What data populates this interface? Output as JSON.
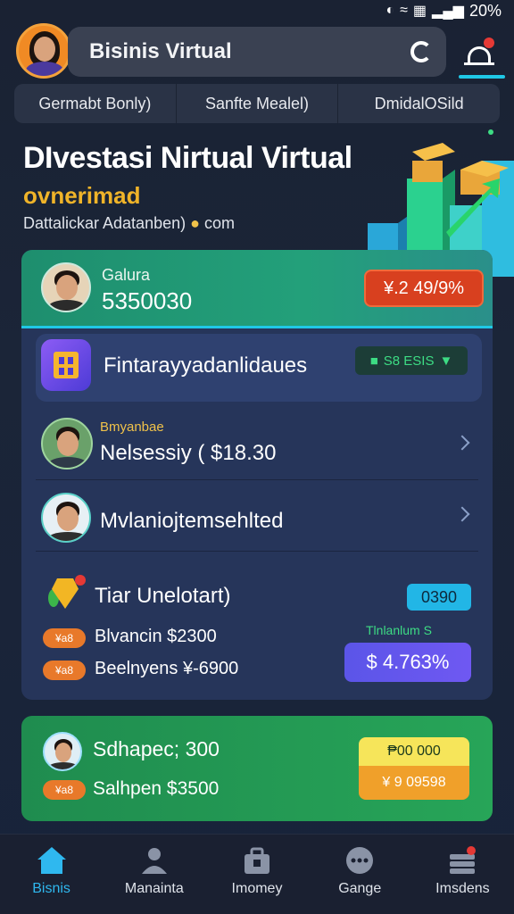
{
  "status_bar": {
    "icons": [
      "nfc-icon",
      "wifi-icon",
      "vibrate-icon",
      "signal-icon"
    ],
    "battery": "20%"
  },
  "header": {
    "title": "Bisinis Virtual"
  },
  "tabs": [
    {
      "label": "Germabt Bonly)"
    },
    {
      "label": "Sanfte Mealel)"
    },
    {
      "label": "DmidalOSild"
    }
  ],
  "hero": {
    "title": "DIvestasi Nirtual Virtual",
    "subtitle": "ovnerimad",
    "caption": "Dattalickar Adatanben)",
    "caption_suffix": "com"
  },
  "card_top": {
    "name": "Galura",
    "amount": "5350030",
    "badge": "¥.2 49/9%"
  },
  "feature": {
    "label": "Fintarayyadanlidaues",
    "pill": "S8 ESIS"
  },
  "list": [
    {
      "tag": "Bmyanbae",
      "label": "Nelsessiy ( $18.30"
    },
    {
      "tag": "",
      "label": "Mvlaniojtemsehlted"
    }
  ],
  "tier": {
    "title": "Tiar Unelotart)",
    "badge": "0390",
    "lines": [
      {
        "chip": "¥a8",
        "text": "Blvancin $2300"
      },
      {
        "chip": "¥a8",
        "text": "Beelnyens ¥-6900"
      }
    ],
    "note": "Tlnlanlum S",
    "button": "$ 4.763%"
  },
  "green_card": {
    "line1": "Sdhapec; 300",
    "chip": "¥a8",
    "line2": "Salhpen $3500",
    "box_top": "₱00 000",
    "box_bottom": "¥ 9 09598"
  },
  "nav": [
    {
      "label": "Bisnis",
      "icon": "home-icon",
      "active": true
    },
    {
      "label": "Manainta",
      "icon": "person-icon",
      "active": false
    },
    {
      "label": "Imomey",
      "icon": "briefcase-icon",
      "active": false
    },
    {
      "label": "Gange",
      "icon": "chat-dots-icon",
      "active": false
    },
    {
      "label": "Imsdens",
      "icon": "stack-icon",
      "active": false
    }
  ],
  "colors": {
    "accent": "#1fc8e6",
    "gold": "#f0b429",
    "active_nav": "#2fb8ef",
    "red_badge": "#d8401f",
    "purple": "#5b55e8"
  }
}
